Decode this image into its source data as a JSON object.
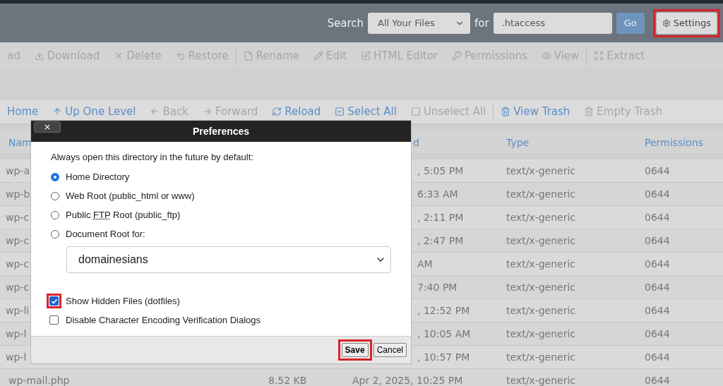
{
  "header": {
    "search_label": "Search",
    "scope": "All Your Files",
    "for_label": "for",
    "query": ".htaccess",
    "go": "Go",
    "settings": {
      "label": "Settings",
      "highlighted": true
    }
  },
  "toolbar": [
    {
      "label": "ad",
      "disabled": true
    },
    {
      "label": "Download",
      "disabled": true
    },
    {
      "label": "Delete",
      "disabled": true
    },
    {
      "label": "Restore",
      "disabled": true
    },
    {
      "label": "Rename",
      "disabled": true
    },
    {
      "label": "Edit",
      "disabled": true
    },
    {
      "label": "HTML Editor",
      "disabled": true
    },
    {
      "label": "Permissions",
      "disabled": true
    },
    {
      "label": "View",
      "disabled": true
    },
    {
      "label": "Extract",
      "disabled": true
    }
  ],
  "navbar": [
    {
      "label": "Home",
      "disabled": false
    },
    {
      "label": "Up One Level",
      "disabled": false
    },
    {
      "label": "Back",
      "disabled": true
    },
    {
      "label": "Forward",
      "disabled": true
    },
    {
      "label": "Reload",
      "disabled": false
    },
    {
      "label": "Select All",
      "disabled": false
    },
    {
      "label": "Unselect All",
      "disabled": true
    },
    {
      "label": "View Trash",
      "disabled": false
    },
    {
      "label": "Empty Trash",
      "disabled": true
    }
  ],
  "table": {
    "columns": [
      "Nam",
      "",
      "d",
      "Type",
      "Permissions"
    ],
    "rows": [
      {
        "kind": "covered",
        "cells": [
          "wp-a",
          "",
          ", 5:05 PM",
          "text/x-generic",
          "0644"
        ]
      },
      {
        "kind": "covered",
        "cells": [
          "wp-b",
          "",
          "6:33 AM",
          "text/x-generic",
          "0644"
        ]
      },
      {
        "kind": "covered",
        "cells": [
          "wp-c",
          "",
          ", 2:11 PM",
          "text/x-generic",
          "0644"
        ]
      },
      {
        "kind": "covered",
        "cells": [
          "wp-c",
          "",
          ", 2:47 PM",
          "text/x-generic",
          "0644"
        ]
      },
      {
        "kind": "covered",
        "cells": [
          "wp-c",
          "",
          "AM",
          "text/x-generic",
          "0644"
        ]
      },
      {
        "kind": "covered",
        "cells": [
          "wp-c",
          "",
          "7:40 PM",
          "text/x-generic",
          "0644"
        ]
      },
      {
        "kind": "covered",
        "cells": [
          "wp-li",
          "",
          ", 12:52 PM",
          "text/x-generic",
          "0644"
        ]
      },
      {
        "kind": "covered",
        "cells": [
          "wp-l",
          "",
          ", 10:05 AM",
          "text/x-generic",
          "0644"
        ]
      },
      {
        "kind": "covered",
        "cells": [
          "wp-l",
          "",
          ", 10:57 PM",
          "text/x-generic",
          "0644"
        ]
      },
      {
        "kind": "full",
        "cells": [
          "wp-mail.php",
          "8.52 KB",
          "Apr 2, 2025, 10:25 PM",
          "text/x-generic",
          "0644"
        ]
      }
    ]
  },
  "dialog": {
    "close": "×",
    "title": "Preferences",
    "prompt": "Always open this directory in the future by default:",
    "options": [
      {
        "label": "Home Directory",
        "selected": true
      },
      {
        "label": "Web Root (public_html or www)",
        "selected": false
      },
      {
        "label": "Public ",
        "abbr": "FTP",
        "label_after": " Root (public_ftp)",
        "selected": false
      },
      {
        "label": "Document Root for:",
        "selected": false
      }
    ],
    "domain": "domainesians",
    "checks": [
      {
        "label": "Show Hidden Files (dotfiles)",
        "checked": true,
        "highlighted": true
      },
      {
        "label": "Disable Character Encoding Verification Dialogs",
        "checked": false,
        "highlighted": false
      }
    ],
    "save": {
      "label": "Save",
      "highlighted": true
    },
    "cancel": "Cancel"
  }
}
